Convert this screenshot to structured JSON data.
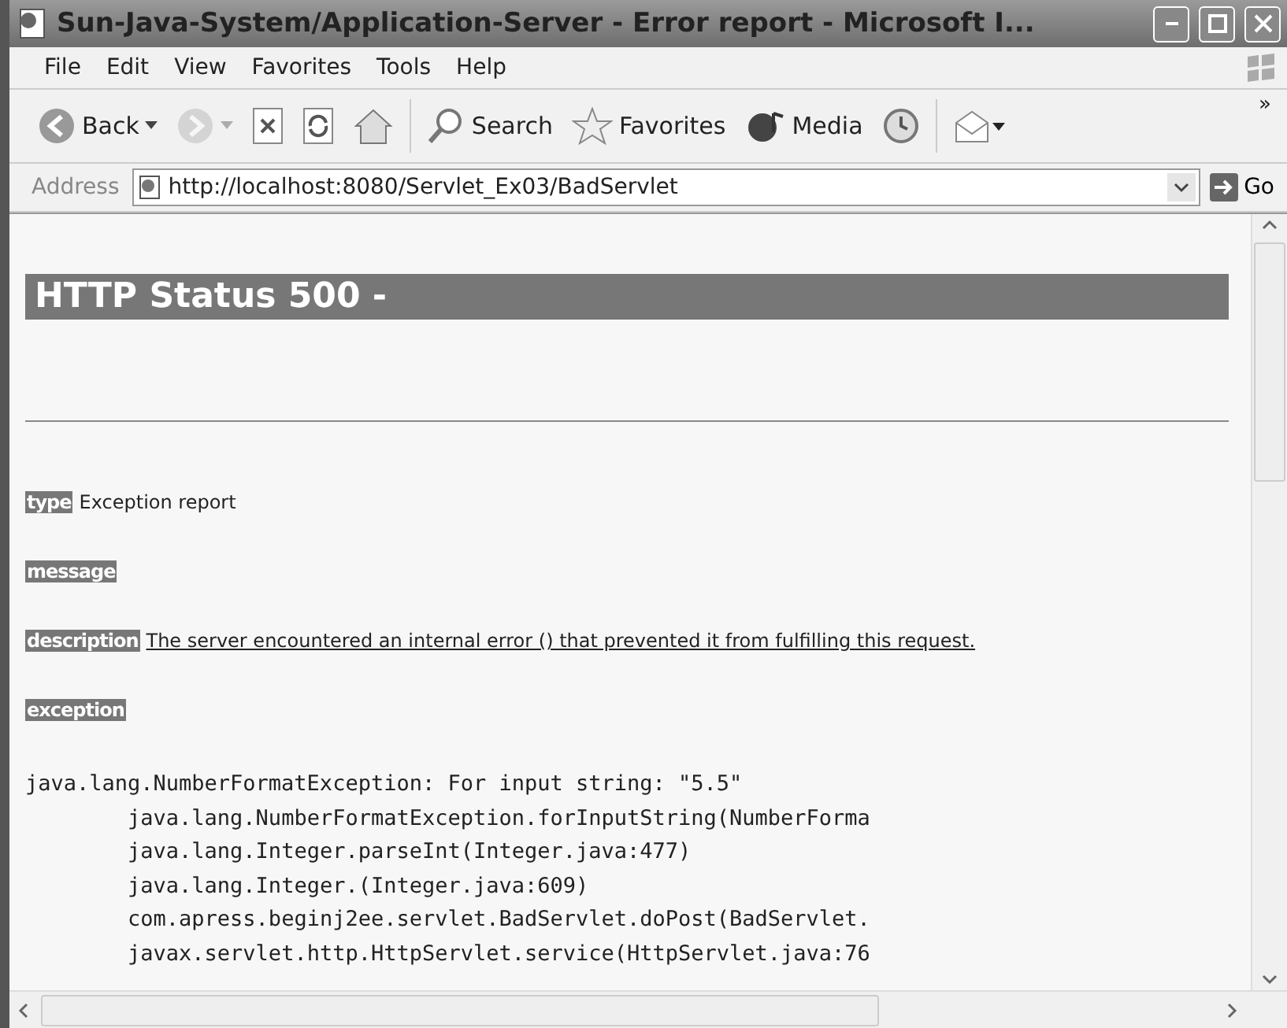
{
  "window": {
    "title": "Sun-Java-System/Application-Server - Error report - Microsoft I..."
  },
  "menu": [
    "File",
    "Edit",
    "View",
    "Favorites",
    "Tools",
    "Help"
  ],
  "toolbar": [
    {
      "kind": "back",
      "label": "Back",
      "disabled": false
    },
    {
      "kind": "forward",
      "disabled": true
    },
    {
      "kind": "stop",
      "disabled": false
    },
    {
      "kind": "refresh",
      "disabled": false
    },
    {
      "kind": "home",
      "disabled": false
    },
    {
      "kind": "search",
      "label": "Search",
      "disabled": false
    },
    {
      "kind": "favorites",
      "label": "Favorites",
      "disabled": false
    },
    {
      "kind": "media",
      "label": "Media",
      "disabled": false
    },
    {
      "kind": "history",
      "disabled": false
    },
    {
      "kind": "mail",
      "disabled": false
    }
  ],
  "toolbar_overflow": "»",
  "address": {
    "label": "Address",
    "value": "http://localhost:8080/Servlet_Ex03/BadServlet",
    "go": "Go"
  },
  "page": {
    "heading": "HTTP Status 500 -",
    "fields": [
      {
        "label": "type",
        "text": "Exception report"
      },
      {
        "label": "message"
      },
      {
        "label": "description",
        "text": "The server encountered an internal error () that prevented it from fulfilling this request.",
        "underlined": true
      },
      {
        "label": "exception"
      }
    ],
    "stack": [
      "java.lang.NumberFormatException: For input string: \"5.5\"",
      "\tjava.lang.NumberFormatException.forInputString(NumberForma",
      "\tjava.lang.Integer.parseInt(Integer.java:477)",
      "\tjava.lang.Integer.(Integer.java:609)",
      "\tcom.apress.beginj2ee.servlet.BadServlet.doPost(BadServlet.",
      "\tjavax.servlet.http.HttpServlet.service(HttpServlet.java:76"
    ]
  }
}
